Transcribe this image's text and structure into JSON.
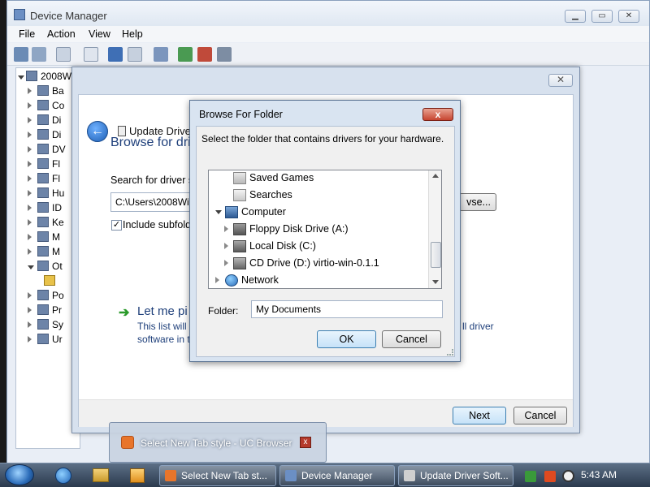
{
  "device_manager": {
    "title": "Device Manager",
    "menu": [
      "File",
      "Action",
      "View",
      "Help"
    ],
    "tree_root": "2008W",
    "tree_items": [
      "Ba",
      "Co",
      "Di",
      "Di",
      "DV",
      "Fl",
      "Fl",
      "Hu",
      "ID",
      "Ke",
      "M",
      "M",
      "Ot",
      "",
      "Po",
      "Pr",
      "Sy",
      "Ur"
    ]
  },
  "wizard": {
    "title": "Update Driver S",
    "heading": "Browse for dri",
    "search_label": "Search for driver so",
    "path_value": "C:\\Users\\2008Win",
    "include_subfolders": "Include subfold",
    "include_checked": true,
    "browse_button": "vse...",
    "let_me_pick": "Let me pi",
    "desc_line1": "This list will s",
    "desc_line1_right": "ll driver",
    "desc_line2": "software in t",
    "next_button": "Next",
    "cancel_button": "Cancel"
  },
  "browse_folder": {
    "title": "Browse For Folder",
    "close_label": "x",
    "prompt": "Select the folder that contains drivers for your hardware.",
    "folders": [
      {
        "label": "Saved Games",
        "icon": "saved-games-icon",
        "indent": 2,
        "arrow": "none"
      },
      {
        "label": "Searches",
        "icon": "searches-icon",
        "indent": 2,
        "arrow": "none"
      },
      {
        "label": "Computer",
        "icon": "computer-icon",
        "indent": 1,
        "arrow": "down"
      },
      {
        "label": "Floppy Disk Drive (A:)",
        "icon": "floppy-drive-icon",
        "indent": 2,
        "arrow": "right"
      },
      {
        "label": "Local Disk (C:)",
        "icon": "local-disk-icon",
        "indent": 2,
        "arrow": "right"
      },
      {
        "label": "CD Drive (D:) virtio-win-0.1.1",
        "icon": "cd-drive-icon",
        "indent": 2,
        "arrow": "right"
      },
      {
        "label": "Network",
        "icon": "network-icon",
        "indent": 1,
        "arrow": "right"
      }
    ],
    "folder_label": "Folder:",
    "folder_value": "My Documents",
    "ok_button": "OK",
    "cancel_button": "Cancel"
  },
  "taskbar_preview": {
    "text": "Select New Tab style - UC Browser",
    "close_label": "x"
  },
  "taskbar": {
    "buttons": [
      "Select New Tab st...",
      "Device Manager",
      "Update Driver Soft..."
    ],
    "clock": "5:43 AM"
  },
  "colors": {
    "accent": "#1e3f7a",
    "window_frame": "#d9e4f1",
    "close_red": "#c64430"
  }
}
